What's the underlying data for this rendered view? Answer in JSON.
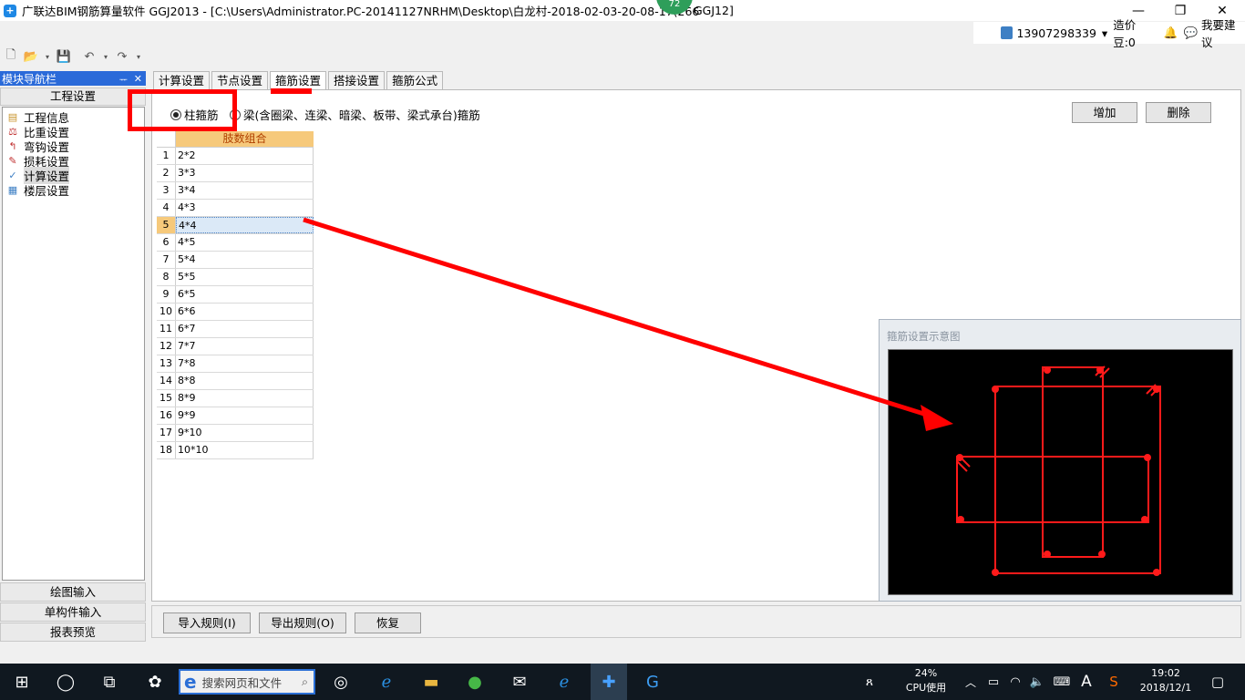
{
  "window": {
    "title": "广联达BIM钢筋算量软件 GGJ2013 - [C:\\Users\\Administrator.PC-20141127NRHM\\Desktop\\白龙村-2018-02-03-20-08-17(266",
    "title_tail": "GGJ12]",
    "badge": "72",
    "minimize": "—",
    "restore": "❐",
    "close": "✕"
  },
  "userbar": {
    "phone": "13907298339",
    "caret": "▾",
    "beans": "造价豆:0",
    "suggest": "我要建议"
  },
  "nav": {
    "header": "模块导航栏",
    "pin": "ᅲ",
    "close": "✕",
    "section": "工程设置",
    "items": [
      {
        "label": "工程信息",
        "icon": "project-info-icon"
      },
      {
        "label": "比重设置",
        "icon": "weight-icon"
      },
      {
        "label": "弯钩设置",
        "icon": "hook-icon"
      },
      {
        "label": "损耗设置",
        "icon": "loss-icon"
      },
      {
        "label": "计算设置",
        "icon": "calc-icon"
      },
      {
        "label": "楼层设置",
        "icon": "floor-icon"
      }
    ],
    "buttons": [
      "绘图输入",
      "单构件输入",
      "报表预览"
    ]
  },
  "tabs": [
    "计算设置",
    "节点设置",
    "箍筋设置",
    "搭接设置",
    "箍筋公式"
  ],
  "options": {
    "column_stirrup": "柱箍筋",
    "beam_stirrup": "梁(含圈梁、连梁、暗梁、板带、梁式承台)箍筋"
  },
  "actions": {
    "add": "增加",
    "delete": "删除",
    "import": "导入规则(I)",
    "export": "导出规则(O)",
    "restore": "恢复"
  },
  "grid": {
    "header": "肢数组合",
    "rows": [
      {
        "n": "1",
        "v": "2*2"
      },
      {
        "n": "2",
        "v": "3*3"
      },
      {
        "n": "3",
        "v": "3*4"
      },
      {
        "n": "4",
        "v": "4*3"
      },
      {
        "n": "5",
        "v": "4*4"
      },
      {
        "n": "6",
        "v": "4*5"
      },
      {
        "n": "7",
        "v": "5*4"
      },
      {
        "n": "8",
        "v": "5*5"
      },
      {
        "n": "9",
        "v": "6*5"
      },
      {
        "n": "10",
        "v": "6*6"
      },
      {
        "n": "11",
        "v": "6*7"
      },
      {
        "n": "12",
        "v": "7*7"
      },
      {
        "n": "13",
        "v": "7*8"
      },
      {
        "n": "14",
        "v": "8*8"
      },
      {
        "n": "15",
        "v": "8*9"
      },
      {
        "n": "16",
        "v": "9*9"
      },
      {
        "n": "17",
        "v": "9*10"
      },
      {
        "n": "18",
        "v": "10*10"
      }
    ],
    "selected_row": 5
  },
  "preview": {
    "title": "箍筋设置示意图"
  },
  "taskbar": {
    "search_placeholder": "搜索网页和文件",
    "cpu_percent": "24%",
    "cpu_label": "CPU使用",
    "ime": "A",
    "time": "19:02",
    "date": "2018/12/1"
  },
  "colors": {
    "annotation_red": "#ff0000",
    "nav_header_blue": "#2a6ad9",
    "grid_header": "#f6c97b",
    "taskbar": "#101820"
  }
}
